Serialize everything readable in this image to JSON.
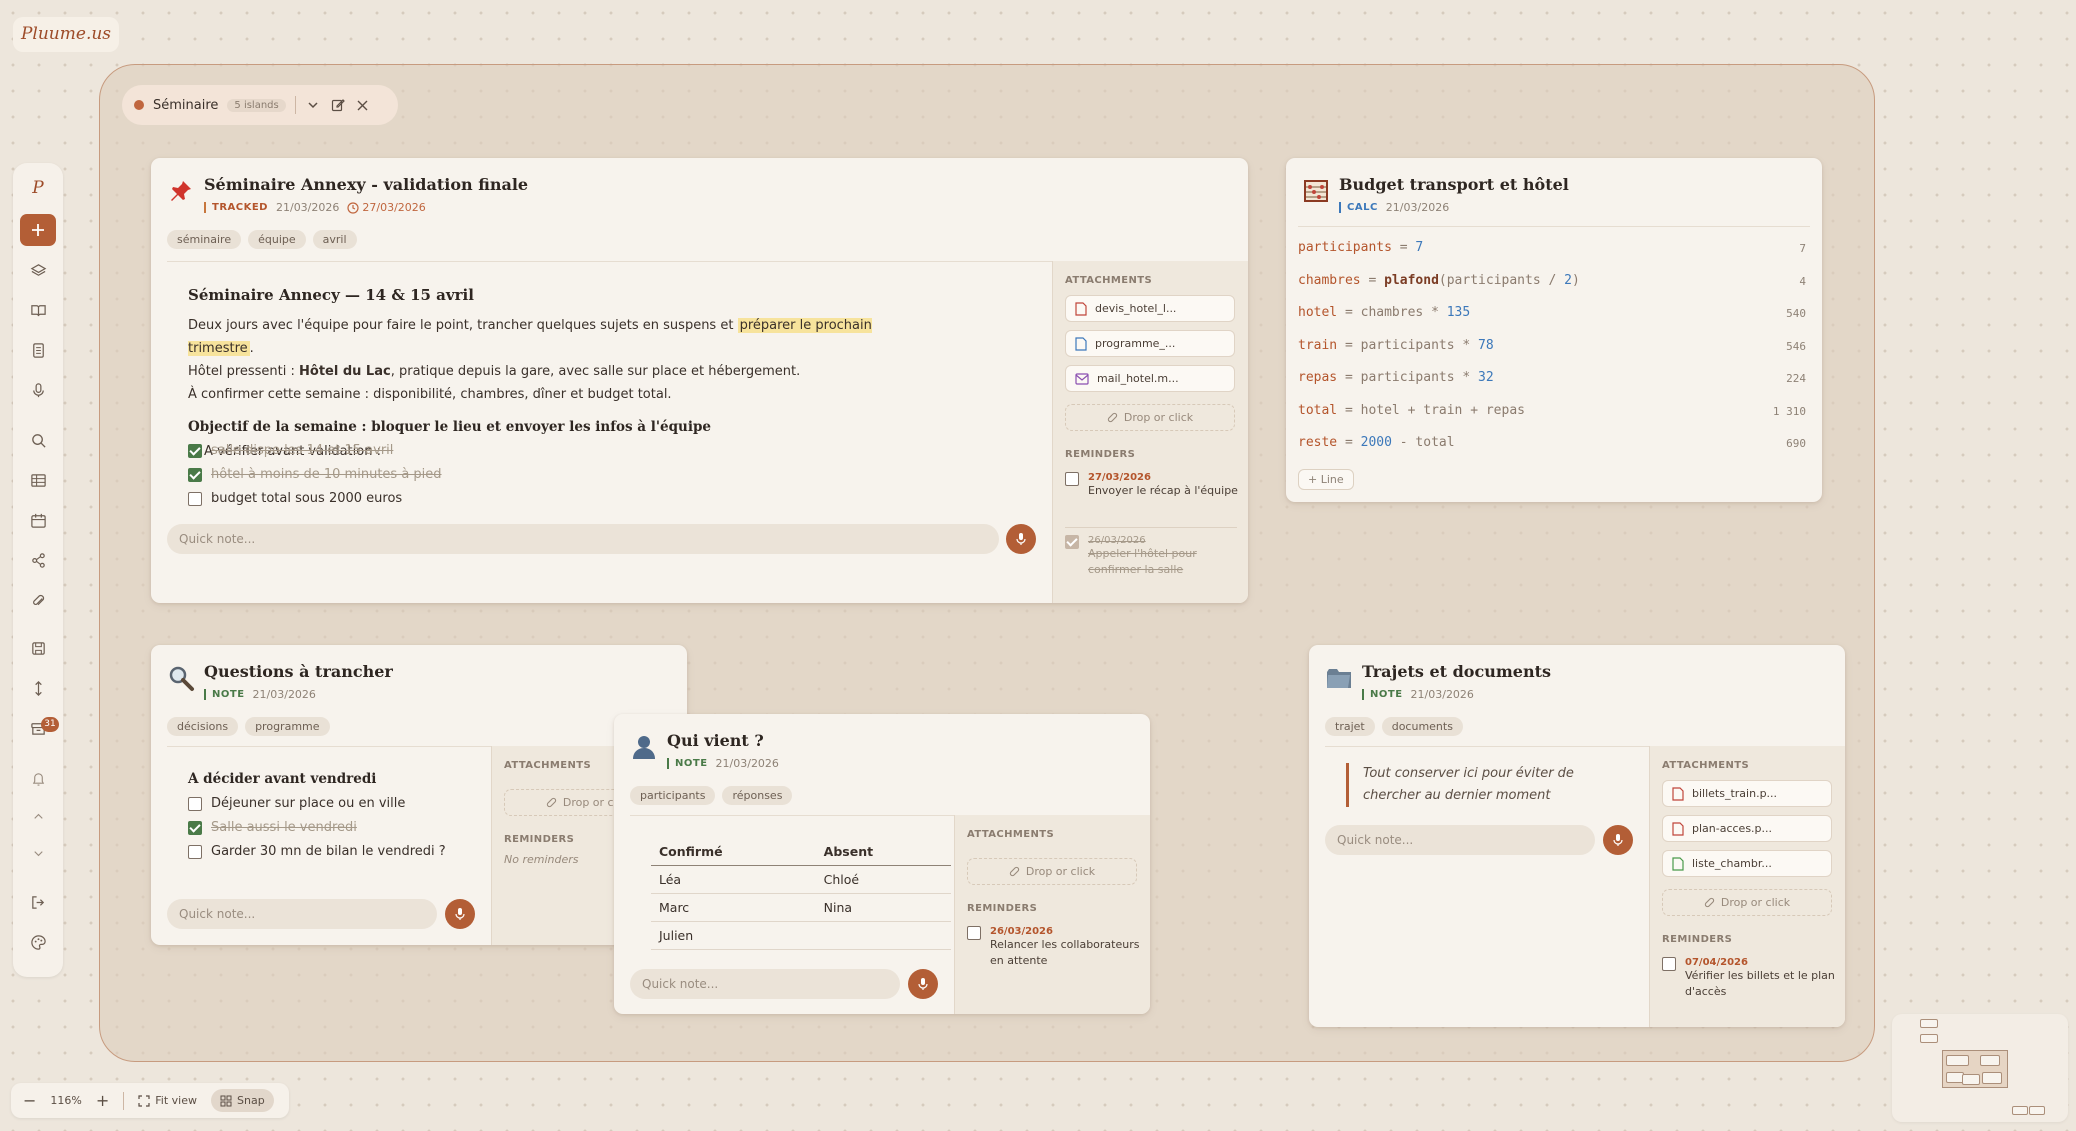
{
  "app": {
    "logo": "Pluume.us"
  },
  "group": {
    "name": "Séminaire",
    "count": "5 islands"
  },
  "sidebar": {
    "logo_letter": "P",
    "archive_badge": "31"
  },
  "colors": {
    "accent": "#b35e36",
    "checked": "#4a7a48",
    "highlight": "#f7e39c"
  },
  "card_main": {
    "title": "Séminaire Annexy - validation finale",
    "kind": "TRACKED",
    "created": "21/03/2026",
    "due": "27/03/2026",
    "tags": [
      "séminaire",
      "équipe",
      "avril"
    ],
    "heading": "Séminaire Annecy — 14 & 15 avril",
    "p1_a": "Deux jours avec l'équipe pour faire le point, trancher quelques sujets en suspens et ",
    "p1_hl": "préparer le prochain trimestre",
    "p1_b": ".",
    "p2_a": "Hôtel pressenti : ",
    "p2_bold": "Hôtel du Lac",
    "p2_b": ", pratique depuis la gare, avec salle sur place et hébergement.",
    "p3": "À confirmer cette semaine : disponibilité, chambres, dîner et budget total.",
    "subheading": "Objectif de la semaine : bloquer le lieu et envoyer les infos à l'équipe",
    "bullet": "A vérifier avant validation :",
    "checks": [
      {
        "label": "salle dispo les 14 et 15 avril",
        "done": true
      },
      {
        "label": "hôtel à moins de 10 minutes à pied",
        "done": true
      },
      {
        "label": "budget total sous 2000 euros",
        "done": false
      }
    ],
    "quick_placeholder": "Quick note...",
    "attachments_label": "ATTACHMENTS",
    "attachments": [
      "devis_hotel_l...",
      "programme_...",
      "mail_hotel.m..."
    ],
    "drop": "Drop or click",
    "reminders_label": "REMINDERS",
    "reminders": [
      {
        "date": "27/03/2026",
        "text": "Envoyer le récap à l'équipe",
        "done": false
      },
      {
        "date": "26/03/2026",
        "text": "Appeler l'hôtel pour confirmer la salle",
        "done": true
      }
    ]
  },
  "card_budget": {
    "title": "Budget transport et hôtel",
    "kind": "CALC",
    "created": "21/03/2026",
    "lines": [
      {
        "var": "participants",
        "expr_parts": [
          {
            "t": "7",
            "c": "n"
          }
        ],
        "result": "7"
      },
      {
        "var": "chambres",
        "expr_parts": [
          {
            "t": "plafond",
            "c": "f"
          },
          {
            "t": "(participants / ",
            "c": "o"
          },
          {
            "t": "2",
            "c": "n"
          },
          {
            "t": ")",
            "c": "o"
          }
        ],
        "result": "4"
      },
      {
        "var": "hotel",
        "expr_parts": [
          {
            "t": "chambres * ",
            "c": "o"
          },
          {
            "t": "135",
            "c": "n"
          }
        ],
        "result": "540"
      },
      {
        "var": "train",
        "expr_parts": [
          {
            "t": "participants * ",
            "c": "o"
          },
          {
            "t": "78",
            "c": "n"
          }
        ],
        "result": "546"
      },
      {
        "var": "repas",
        "expr_parts": [
          {
            "t": "participants * ",
            "c": "o"
          },
          {
            "t": "32",
            "c": "n"
          }
        ],
        "result": "224"
      },
      {
        "var": "total",
        "expr_parts": [
          {
            "t": "hotel + train + repas",
            "c": "o"
          }
        ],
        "result": "1 310"
      },
      {
        "var": "reste",
        "expr_parts": [
          {
            "t": "2000",
            "c": "n"
          },
          {
            "t": " - total",
            "c": "o"
          }
        ],
        "result": "690"
      }
    ],
    "add_line": "+ Line"
  },
  "card_questions": {
    "title": "Questions à trancher",
    "kind": "NOTE",
    "created": "21/03/2026",
    "tags": [
      "décisions",
      "programme"
    ],
    "heading": "A décider avant vendredi",
    "checks": [
      {
        "label": "Déjeuner sur place ou en ville",
        "done": false
      },
      {
        "label": "Salle aussi le vendredi",
        "done": true
      },
      {
        "label": "Garder 30 mn de bilan le vendredi ?",
        "done": false
      }
    ],
    "quick_placeholder": "Quick note...",
    "attachments_label": "ATTACHMENTS",
    "drop": "Drop or click",
    "reminders_label": "REMINDERS",
    "no_reminders": "No reminders"
  },
  "card_who": {
    "title": "Qui vient ?",
    "kind": "NOTE",
    "created": "21/03/2026",
    "tags": [
      "participants",
      "réponses"
    ],
    "columns": [
      "Confirmé",
      "Absent"
    ],
    "rows": [
      [
        "Léa",
        "Chloé"
      ],
      [
        "Marc",
        "Nina"
      ],
      [
        "Julien",
        ""
      ]
    ],
    "quick_placeholder": "Quick note...",
    "attachments_label": "ATTACHMENTS",
    "drop": "Drop or click",
    "reminders_label": "REMINDERS",
    "reminder": {
      "date": "26/03/2026",
      "text": "Relancer les collaborateurs en attente"
    }
  },
  "card_trips": {
    "title": "Trajets et documents",
    "kind": "NOTE",
    "created": "21/03/2026",
    "tags": [
      "trajet",
      "documents"
    ],
    "quote": "Tout conserver ici pour éviter de chercher au dernier moment",
    "quick_placeholder": "Quick note...",
    "attachments_label": "ATTACHMENTS",
    "attachments": [
      "billets_train.p...",
      "plan-acces.p...",
      "liste_chambr..."
    ],
    "drop": "Drop or click",
    "reminders_label": "REMINDERS",
    "reminder": {
      "date": "07/04/2026",
      "text": "Vérifier les billets et le plan d'accès"
    }
  },
  "zoom": {
    "level": "116%",
    "fit": "Fit view",
    "snap": "Snap"
  }
}
